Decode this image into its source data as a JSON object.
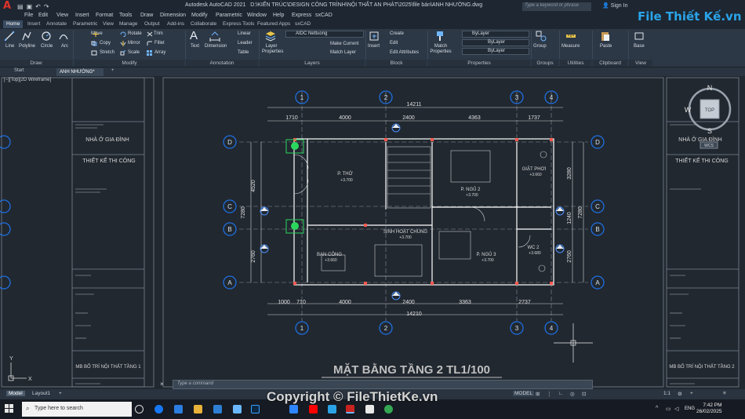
{
  "titlebar": {
    "app_name": "Autodesk AutoCAD 2021",
    "file_path": "D:\\KIẾN TRÚC\\DESIGN CÔNG TRÌNH\\NỘI THẤT AN PHÁT\\2025\\file bán\\ANH NHƯỜNG.dwg",
    "search_placeholder": "Type a keyword or phrase",
    "sign_in": "Sign In",
    "logo_letter": "A"
  },
  "menu": [
    "File",
    "Edit",
    "View",
    "Insert",
    "Format",
    "Tools",
    "Draw",
    "Dimension",
    "Modify",
    "Parametric",
    "Window",
    "Help",
    "Express",
    "sxCAD"
  ],
  "ribbon_tabs": [
    "Home",
    "Insert",
    "Annotate",
    "Parametric",
    "View",
    "Manage",
    "Output",
    "Add-ins",
    "Collaborate",
    "Express Tools",
    "Featured Apps",
    "sxCAD"
  ],
  "ribbon_tab_active": "Home",
  "ribbon": {
    "draw": {
      "title": "Draw",
      "tools": [
        "Line",
        "Polyline",
        "Circle",
        "Arc"
      ]
    },
    "modify": {
      "title": "Modify",
      "tools": [
        "Move",
        "Rotate",
        "Trim",
        "Copy",
        "Mirror",
        "Fillet",
        "Stretch",
        "Scale",
        "Array"
      ]
    },
    "annotation": {
      "title": "Annotation",
      "tools": [
        "Text",
        "Dimension",
        "Linear",
        "Leader",
        "Table"
      ]
    },
    "layers": {
      "title": "Layers",
      "layer_properties": "Layer Properties",
      "current_layer": "AIDC Nettuong",
      "make_current": "Make Current",
      "match_layer": "Match Layer"
    },
    "block": {
      "title": "Block",
      "insert": "Insert",
      "create": "Create",
      "edit": "Edit",
      "edit_attributes": "Edit Attributes"
    },
    "properties": {
      "title": "Properties",
      "match": "Match Properties",
      "color": "ByLayer",
      "linetype": "ByLayer",
      "lineweight": "ByLayer"
    },
    "groups": {
      "title": "Groups",
      "group": "Group"
    },
    "utilities": {
      "title": "Utilities",
      "measure": "Measure"
    },
    "clipboard": {
      "title": "Clipboard",
      "paste": "Paste"
    },
    "view": {
      "title": "View",
      "base": "Base"
    }
  },
  "file_tabs": {
    "start": "Start",
    "current": "ANH NHƯỜNG*",
    "add": "+"
  },
  "viewport_label": "[−][Top][2D Wireframe]",
  "viewcube": {
    "north": "N",
    "south": "S",
    "west": "W",
    "top": "TOP",
    "ucs": "WCS"
  },
  "drawing": {
    "title": "MẶT BẰNG TẦNG 2 TL1/100",
    "grid_numbers": [
      "1",
      "2",
      "3",
      "4"
    ],
    "grid_letters": [
      "D",
      "C",
      "B",
      "A"
    ],
    "dims_top": [
      "14211",
      "1710",
      "4000",
      "2400",
      "4363",
      "1737"
    ],
    "dims_bottom": [
      "1000",
      "710",
      "4000",
      "2400",
      "3363",
      "2737",
      "14210"
    ],
    "dims_left": [
      "4520",
      "7280",
      "2760"
    ],
    "dims_right": [
      "3280",
      "7280",
      "1240",
      "2760"
    ],
    "rooms": [
      {
        "name": "P. THỜ",
        "level": "+3.700"
      },
      {
        "name": "P. NGỦ 2",
        "level": "+3.700"
      },
      {
        "name": "GIẶT PHƠI",
        "level": "+3.660"
      },
      {
        "name": "SINH HOẠT CHUNG",
        "level": "+3.700"
      },
      {
        "name": "BAN CÔNG",
        "level": "+3.660"
      },
      {
        "name": "P. NGỦ 3",
        "level": "+3.700"
      },
      {
        "name": "WC 2",
        "level": "+3.680"
      }
    ]
  },
  "title_block_left": {
    "project": "NHÀ Ở GIA ĐÌNH",
    "phase": "THIẾT KẾ THI CÔNG",
    "sheet": "MB BỐ TRÍ NỘI THẤT TẦNG 1"
  },
  "title_block_right": {
    "project": "NHÀ Ở GIA ĐÌNH",
    "phase": "THIẾT KẾ THI CÔNG",
    "sheet": "MB BỐ TRÍ NỘI THẤT TẦNG 2"
  },
  "command": {
    "close": "×",
    "prompt": "Type a command"
  },
  "layout_tabs": [
    "Model",
    "Layout1",
    "+"
  ],
  "status": {
    "mode": "MODEL",
    "scale": "1:1"
  },
  "taskbar": {
    "search_placeholder": "Type here to search",
    "lang": "ENG",
    "time": "7:42 PM",
    "date": "26/02/2025"
  },
  "watermark": {
    "logo": "File Thiết Kế.vn",
    "copyright": "Copyright © FileThietKe.vn"
  },
  "colors": {
    "bg": "#212830",
    "grid_bubble": "#1f6fe0",
    "dim": "#d9d9d9",
    "wall": "#ffffff",
    "accent_yellow": "#e8e12a"
  }
}
